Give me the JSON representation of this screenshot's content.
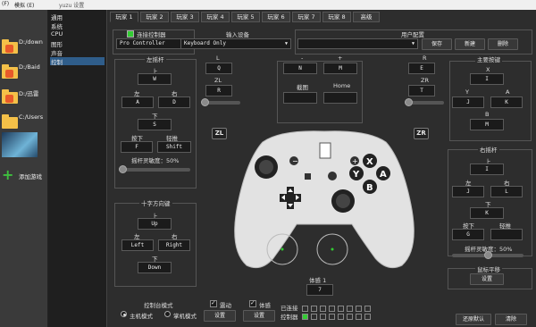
{
  "menu": {
    "items": [
      "(F)",
      "模拟 (E)"
    ],
    "window_title": "yuzu 设置"
  },
  "games": [
    {
      "label": "D:/down"
    },
    {
      "label": "D:/Baid"
    },
    {
      "label": "D:/迅雷"
    },
    {
      "label": "C:/Users"
    },
    {
      "label": ""
    },
    {
      "label": "添加游戏"
    }
  ],
  "categories": [
    "通用",
    "系统",
    "CPU",
    "图形",
    "声音",
    "控制"
  ],
  "selected_category": "控制",
  "tabs": [
    "玩家 1",
    "玩家 2",
    "玩家 3",
    "玩家 4",
    "玩家 5",
    "玩家 6",
    "玩家 7",
    "玩家 8",
    "高级"
  ],
  "connect": {
    "label": "连接控制器",
    "value": "Pro Controller"
  },
  "input_device": {
    "label": "输入设备",
    "value": "Keyboard Only"
  },
  "profile": {
    "label": "用户配置",
    "value": "",
    "save": "保存",
    "new": "新建",
    "delete": "删除"
  },
  "left_stick": {
    "title": "左摇杆",
    "up": "上",
    "up_key": "W",
    "left": "左",
    "left_key": "A",
    "right": "右",
    "right_key": "D",
    "down": "下",
    "down_key": "S",
    "press": "按下",
    "press_key": "F",
    "modifier": "轻推",
    "modifier_key": "Shift",
    "sensitivity": "摇杆灵敏度：50%"
  },
  "shoulder_left": {
    "l": "L",
    "l_key": "Q",
    "zl": "ZL",
    "zl_key": "R"
  },
  "center": {
    "minus": "-",
    "minus_key": "N",
    "plus": "+",
    "plus_key": "M",
    "capture": "截图",
    "capture_key": "",
    "home": "Home",
    "home_key": ""
  },
  "shoulder_right": {
    "r": "R",
    "r_key": "E",
    "zr": "ZR",
    "zr_key": "T"
  },
  "face": {
    "title": "主要按键",
    "x": "X",
    "x_key": "I",
    "y": "Y",
    "y_key": "J",
    "a": "A",
    "a_key": "K",
    "b": "B",
    "b_key": "M"
  },
  "dpad": {
    "title": "十字方向键",
    "up": "上",
    "up_key": "Up",
    "left": "左",
    "left_key": "Left",
    "right": "右",
    "right_key": "Right",
    "down": "下",
    "down_key": "Down"
  },
  "right_stick": {
    "title": "右摇杆",
    "up": "上",
    "up_key": "I",
    "left": "左",
    "left_key": "J",
    "right": "右",
    "right_key": "L",
    "down": "下",
    "down_key": "K",
    "press": "按下",
    "press_key": "G",
    "modifier": "轻推",
    "modifier_key": "",
    "sensitivity": "摇杆灵敏度：50%"
  },
  "mouse_pan": {
    "title": "鼠标平移",
    "button": "设置"
  },
  "zl_badge": "ZL",
  "zr_badge": "ZR",
  "motion": {
    "label": "体感 1",
    "key": "7"
  },
  "console_mode": {
    "title": "控制台模式",
    "docked": "主机模式",
    "handheld": "掌机模式"
  },
  "vibration": {
    "label": "震动",
    "button": "设置"
  },
  "motion_opt": {
    "label": "体感",
    "button": "设置"
  },
  "connected": {
    "label": "已连接",
    "label2": "控制器"
  },
  "footer": {
    "defaults": "还原默认",
    "clear": "清除"
  },
  "controller_face": {
    "x": "X",
    "y": "Y",
    "a": "A",
    "b": "B",
    "minus": "−",
    "plus": "+"
  },
  "colors": {
    "accent": "#2f5d8a",
    "connected": "#33cc33",
    "controller": "#e6e6e6"
  }
}
